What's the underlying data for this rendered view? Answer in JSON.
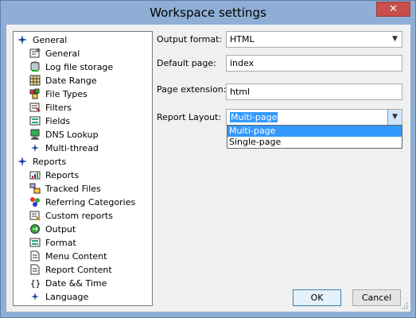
{
  "window": {
    "title": "Workspace settings",
    "close_label": "✕"
  },
  "tree": {
    "groups": [
      {
        "label": "General",
        "icon": "blue-star-icon",
        "items": [
          {
            "label": "General",
            "icon": "general-settings-icon"
          },
          {
            "label": "Log file storage",
            "icon": "database-icon"
          },
          {
            "label": "Date Range",
            "icon": "calendar-icon"
          },
          {
            "label": "File Types",
            "icon": "file-types-icon"
          },
          {
            "label": "Filters",
            "icon": "filter-icon"
          },
          {
            "label": "Fields",
            "icon": "fields-icon"
          },
          {
            "label": "DNS Lookup",
            "icon": "computer-icon"
          },
          {
            "label": "Multi-thread",
            "icon": "blue-star-icon"
          }
        ]
      },
      {
        "label": "Reports",
        "icon": "blue-star-icon",
        "items": [
          {
            "label": "Reports",
            "icon": "reports-icon"
          },
          {
            "label": "Tracked Files",
            "icon": "tracked-files-icon"
          },
          {
            "label": "Referring Categories",
            "icon": "referring-icon"
          },
          {
            "label": "Custom reports",
            "icon": "custom-reports-icon"
          },
          {
            "label": "Output",
            "icon": "output-icon"
          },
          {
            "label": "Format",
            "icon": "format-icon"
          },
          {
            "label": "Menu Content",
            "icon": "document-icon"
          },
          {
            "label": "Report Content",
            "icon": "document-icon"
          },
          {
            "label": "Date && Time",
            "icon": "braces-icon"
          },
          {
            "label": "Language",
            "icon": "blue-star-icon"
          }
        ]
      }
    ]
  },
  "form": {
    "output_format": {
      "label": "Output format:",
      "value": "HTML"
    },
    "default_page": {
      "label": "Default page:",
      "value": "index"
    },
    "page_extension": {
      "label": "Page extension:",
      "value": "html"
    },
    "report_layout": {
      "label": "Report Layout:",
      "value": "Multi-page",
      "options": [
        "Multi-page",
        "Single-page"
      ],
      "highlighted": "Multi-page"
    }
  },
  "buttons": {
    "ok": "OK",
    "cancel": "Cancel"
  },
  "colors": {
    "titlebar": "#8eaed6",
    "selection": "#3399ff",
    "close": "#c7504b"
  }
}
